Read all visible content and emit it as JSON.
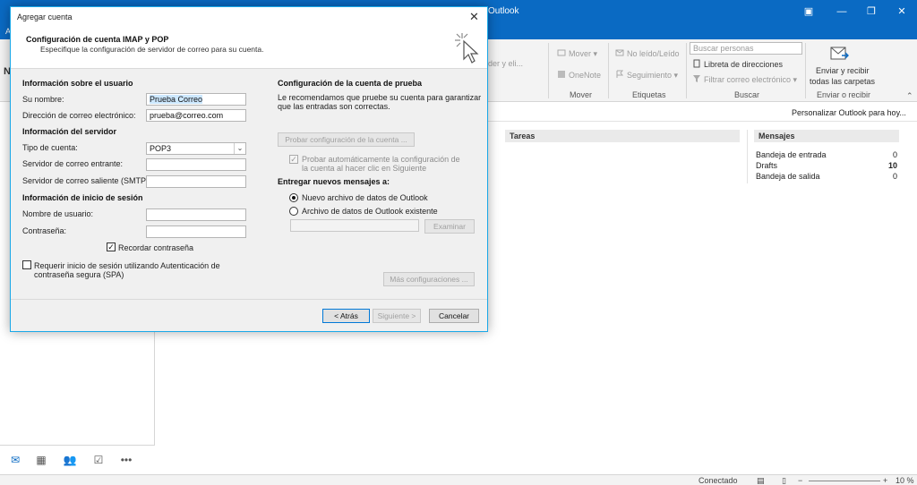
{
  "outlook": {
    "title_fragment": "Outlook",
    "ribbon": {
      "mover_label": "Mover",
      "onenote_label": "OneNote",
      "mover_group": "Mover",
      "noleido_label": "No leído/Leído",
      "seguimiento_label": "Seguimiento",
      "etiquetas_group": "Etiquetas",
      "search_placeholder": "Buscar personas",
      "libreta_label": "Libreta de direcciones",
      "filtrar_label": "Filtrar correo electrónico",
      "buscar_group": "Buscar",
      "enviar_label_1": "Enviar y recibir",
      "enviar_label_2": "todas las carpetas",
      "enviar_group": "Enviar o recibir",
      "truncated_1": "nder y eli...",
      "truncated_left": "A"
    },
    "left_letter": "N",
    "customize_link": "Personalizar Outlook para hoy...",
    "tareas_title": "Tareas",
    "mensajes_title": "Mensajes",
    "mensajes": [
      {
        "name": "Bandeja de entrada",
        "count": "0"
      },
      {
        "name": "Drafts",
        "count": "10"
      },
      {
        "name": "Bandeja de salida",
        "count": "0"
      }
    ],
    "status": {
      "connected": "Conectado",
      "zoom": "10 %",
      "zoom_minus": "−",
      "zoom_plus": "+"
    }
  },
  "dialog": {
    "title": "Agregar cuenta",
    "header_title": "Configuración de cuenta IMAP y POP",
    "header_subtitle": "Especifique la configuración de servidor de correo para su cuenta.",
    "user_section": "Información sobre el usuario",
    "name_label": "Su nombre:",
    "name_value": "Prueba Correo",
    "email_label": "Dirección de correo electrónico:",
    "email_value": "prueba@correo.com",
    "server_section": "Información del servidor",
    "account_type_label": "Tipo de cuenta:",
    "account_type_value": "POP3",
    "incoming_label": "Servidor de correo entrante:",
    "incoming_value": "",
    "outgoing_label": "Servidor de correo saliente (SMTP):",
    "outgoing_value": "",
    "login_section": "Información de inicio de sesión",
    "username_label": "Nombre de usuario:",
    "username_value": "",
    "password_label": "Contraseña:",
    "password_value": "",
    "remember_password_label": "Recordar contraseña",
    "remember_password_checked": true,
    "spa_label_1": "Requerir inicio de sesión utilizando Autenticación de",
    "spa_label_2": "contraseña segura (SPA)",
    "spa_checked": false,
    "test_section": "Configuración de la cuenta de prueba",
    "test_desc_1": "Le recomendamos que pruebe su cuenta para garantizar",
    "test_desc_2": "que las entradas son correctas.",
    "test_button": "Probar configuración de la cuenta ...",
    "auto_test_label_1": "Probar automáticamente la configuración de",
    "auto_test_label_2": "la cuenta al hacer clic en Siguiente",
    "deliver_section": "Entregar nuevos mensajes a:",
    "new_data_file_label": "Nuevo archivo de datos de Outlook",
    "existing_data_file_label": "Archivo de datos de Outlook existente",
    "examinar_button": "Examinar",
    "more_settings_button": "Más configuraciones ...",
    "back_button": "< Atrás",
    "next_button": "Siguiente >",
    "cancel_button": "Cancelar"
  }
}
